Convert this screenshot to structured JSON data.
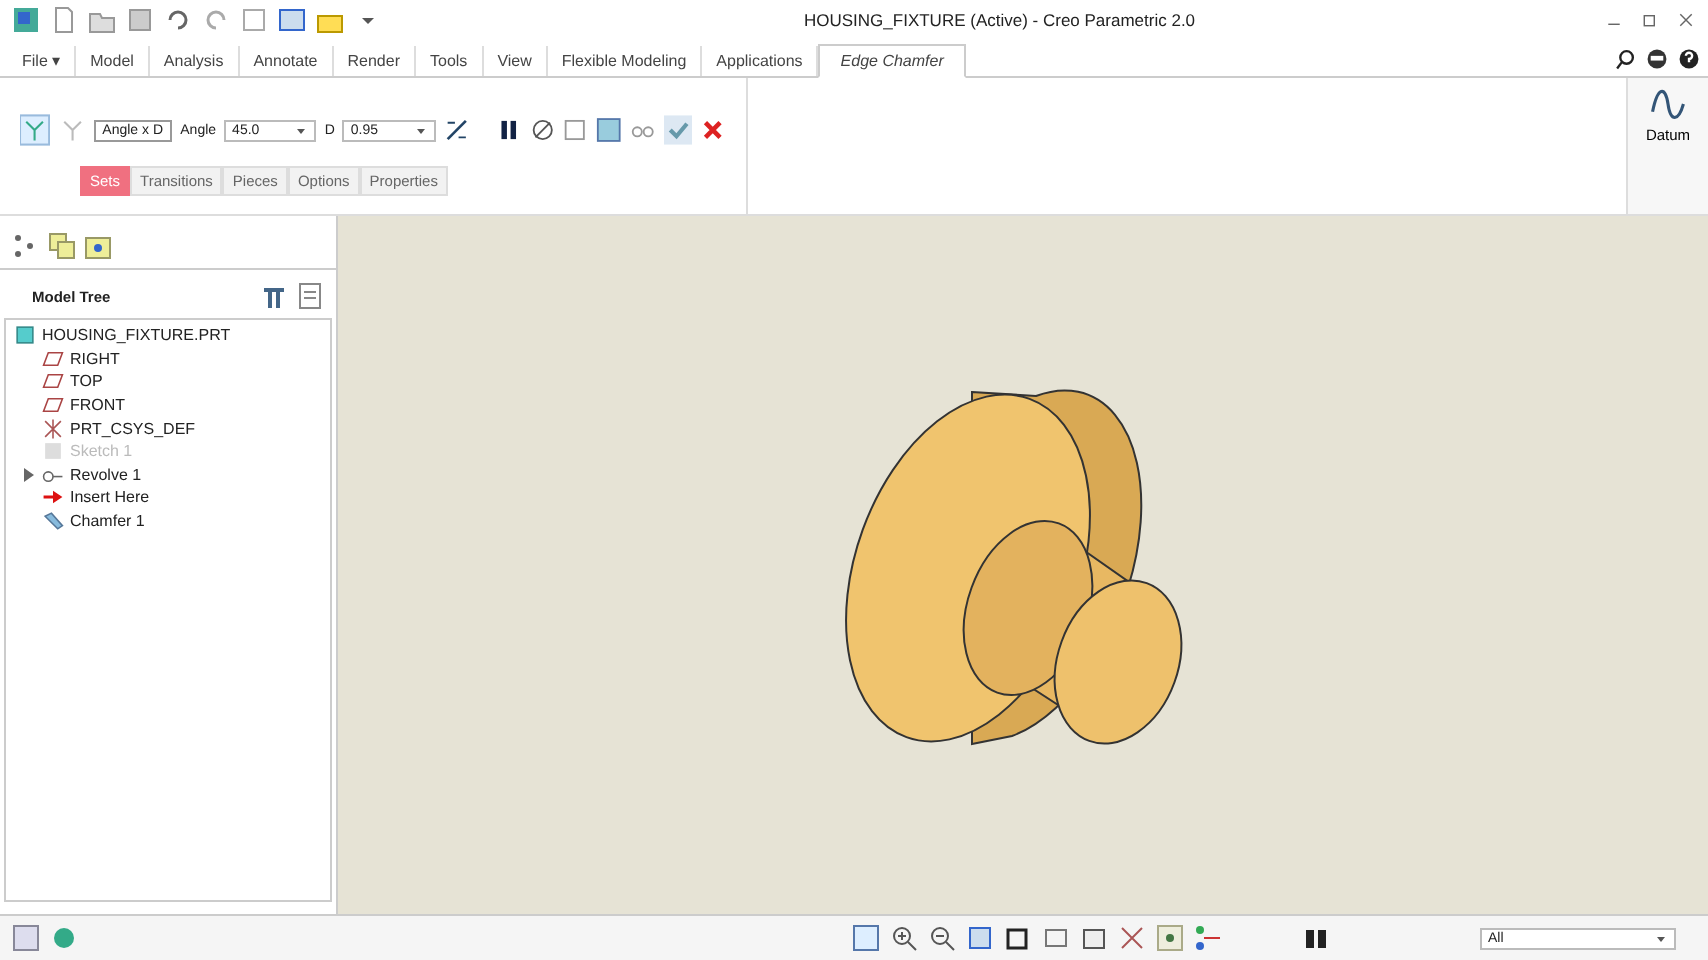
{
  "window": {
    "title": "HOUSING_FIXTURE (Active) - Creo Parametric 2.0"
  },
  "menu_tabs": [
    {
      "label": "File ▾",
      "selected": false
    },
    {
      "label": "Model",
      "selected": false
    },
    {
      "label": "Analysis",
      "selected": false
    },
    {
      "label": "Annotate",
      "selected": false
    },
    {
      "label": "Render",
      "selected": false
    },
    {
      "label": "Tools",
      "selected": false
    },
    {
      "label": "View",
      "selected": false
    },
    {
      "label": "Flexible Modeling",
      "selected": false
    },
    {
      "label": "Applications",
      "selected": false
    },
    {
      "label": "Edge Chamfer",
      "selected": true
    }
  ],
  "ribbon": {
    "scheme": "Angle x D",
    "angle_label": "Angle",
    "angle": "45.0",
    "d_label": "D",
    "d": "0.95",
    "datum": "Datum"
  },
  "sub_tabs": [
    {
      "label": "Sets",
      "selected": true
    },
    {
      "label": "Transitions",
      "selected": false
    },
    {
      "label": "Pieces",
      "selected": false
    },
    {
      "label": "Options",
      "selected": false
    },
    {
      "label": "Properties",
      "selected": false
    }
  ],
  "tree": {
    "title": "Model Tree",
    "items": [
      {
        "kind": "part",
        "label": "HOUSING_FIXTURE.PRT",
        "disabled": false
      },
      {
        "kind": "plane",
        "label": "RIGHT",
        "disabled": false
      },
      {
        "kind": "plane",
        "label": "TOP",
        "disabled": false
      },
      {
        "kind": "plane",
        "label": "FRONT",
        "disabled": false
      },
      {
        "kind": "csys",
        "label": "PRT_CSYS_DEF",
        "disabled": false
      },
      {
        "kind": "sketch",
        "label": "Sketch 1",
        "disabled": true
      },
      {
        "kind": "revolve",
        "label": "Revolve 1",
        "disabled": false,
        "expanded": false
      },
      {
        "kind": "insert",
        "label": "Insert Here",
        "disabled": false
      },
      {
        "kind": "chamfer",
        "label": "Chamfer 1",
        "disabled": false
      }
    ]
  },
  "status_bar": {
    "filter": "All"
  }
}
